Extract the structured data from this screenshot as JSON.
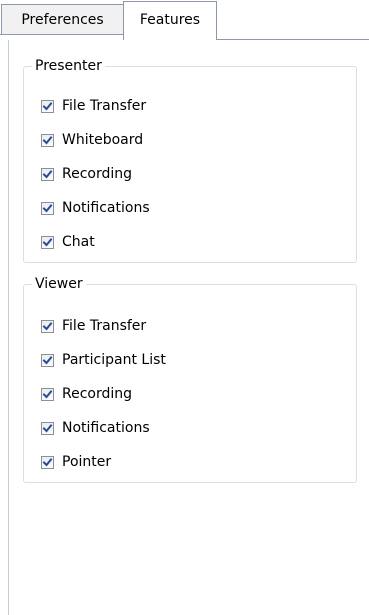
{
  "tabs": [
    {
      "label": "Preferences",
      "active": false
    },
    {
      "label": "Features",
      "active": true
    }
  ],
  "presenter": {
    "title": "Presenter",
    "items": [
      {
        "label": "File Transfer",
        "checked": true
      },
      {
        "label": "Whiteboard",
        "checked": true
      },
      {
        "label": "Recording",
        "checked": true
      },
      {
        "label": "Notifications",
        "checked": true
      },
      {
        "label": "Chat",
        "checked": true
      }
    ]
  },
  "viewer": {
    "title": "Viewer",
    "items": [
      {
        "label": "File Transfer",
        "checked": true
      },
      {
        "label": "Participant List",
        "checked": true
      },
      {
        "label": "Recording",
        "checked": true
      },
      {
        "label": "Notifications",
        "checked": true
      },
      {
        "label": "Pointer",
        "checked": true
      }
    ]
  },
  "colors": {
    "checkmark": "#2b4a8f",
    "border": "#8d99a8",
    "group_border": "#d5dfe5"
  }
}
